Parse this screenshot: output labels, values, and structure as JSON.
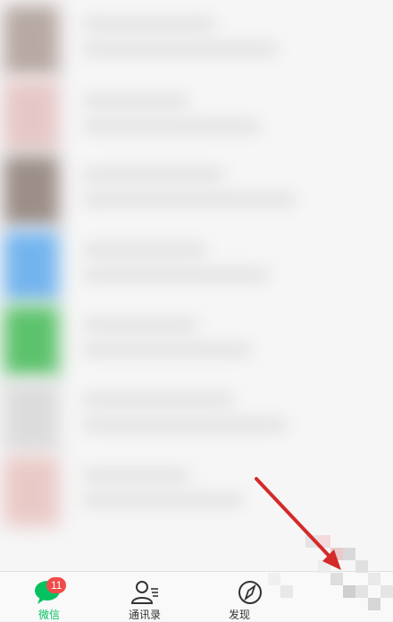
{
  "tabbar": {
    "tabs": [
      {
        "label": "微信",
        "icon": "chat-bubble-icon",
        "active": true,
        "badge": "11"
      },
      {
        "label": "通讯录",
        "icon": "contacts-icon",
        "active": false
      },
      {
        "label": "发现",
        "icon": "compass-icon",
        "active": false
      },
      {
        "label": "",
        "icon": "obscured",
        "active": false
      }
    ]
  },
  "colors": {
    "accent": "#07c160",
    "badge": "#f04a4a",
    "arrow": "#d42a2a"
  }
}
